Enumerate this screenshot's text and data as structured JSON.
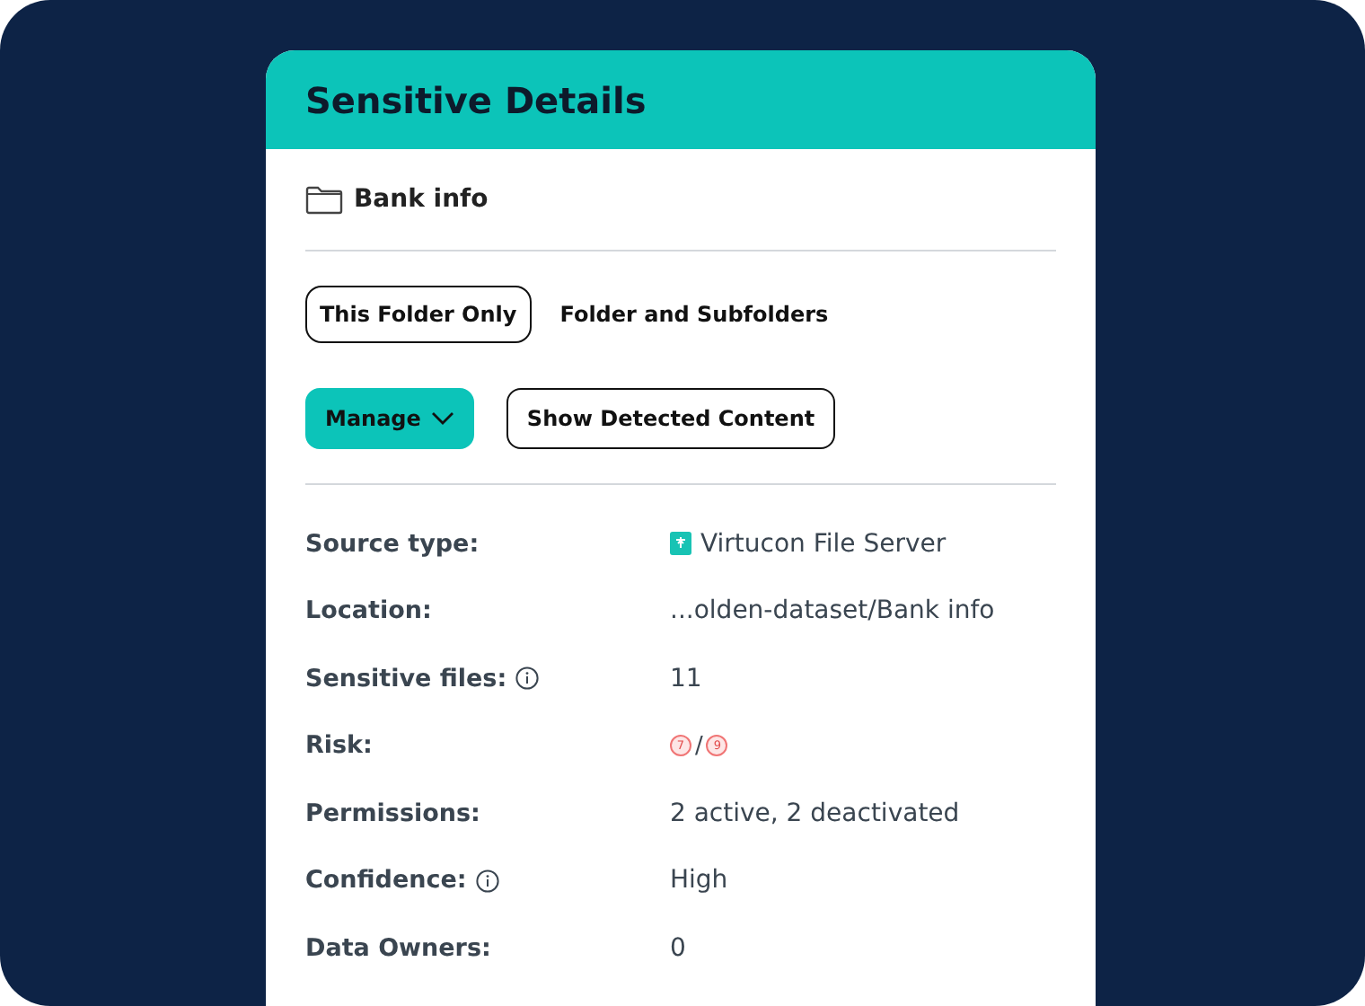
{
  "panel": {
    "title": "Sensitive Details"
  },
  "folder": {
    "name": "Bank info"
  },
  "scope_tabs": [
    {
      "label": "This Folder Only",
      "selected": true
    },
    {
      "label": "Folder and Subfolders",
      "selected": false
    }
  ],
  "actions": [
    {
      "label": "Manage",
      "kind": "menu"
    },
    {
      "label": "Show Detected Content",
      "kind": "outline"
    }
  ],
  "details": [
    {
      "label": "Source type:",
      "info": false,
      "kind": "source",
      "value": "Virtucon File Server"
    },
    {
      "label": "Location:",
      "info": false,
      "kind": "text",
      "value": "...olden-dataset/Bank info"
    },
    {
      "label": "Sensitive files:",
      "info": true,
      "kind": "text",
      "value": "11"
    },
    {
      "label": "Risk:",
      "info": false,
      "kind": "risk",
      "values": [
        "7",
        "9"
      ],
      "separator": "/"
    },
    {
      "label": "Permissions:",
      "info": false,
      "kind": "text",
      "value": "2 active, 2 deactivated"
    },
    {
      "label": "Confidence:",
      "info": true,
      "kind": "text",
      "value": "High"
    },
    {
      "label": "Data Owners:",
      "info": false,
      "kind": "text",
      "value": "0"
    }
  ]
}
